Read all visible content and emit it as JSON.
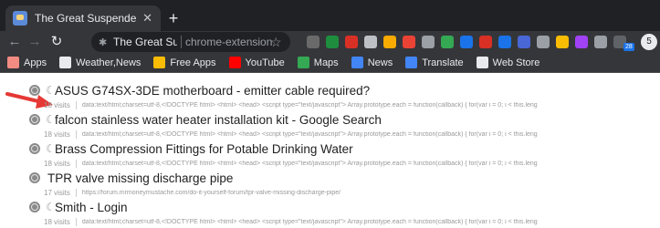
{
  "tab": {
    "title": "The Great Suspender - Recovery",
    "close": "✕",
    "new_tab": "+"
  },
  "toolbar": {
    "back": "←",
    "forward": "→",
    "reload": "↻",
    "puzzle": "✱",
    "omnibox_title": "The Great Susp",
    "omnibox_url": "chrome-extension://...",
    "star": "☆"
  },
  "extensions": [
    {
      "name": "ext-1-icon",
      "color": "#6a6a6a"
    },
    {
      "name": "ext-2-icon",
      "color": "#1e8e3e"
    },
    {
      "name": "ext-3-icon",
      "color": "#d93025"
    },
    {
      "name": "ext-4-icon",
      "color": "#bdc1c6"
    },
    {
      "name": "ext-5-icon",
      "color": "#f9ab00"
    },
    {
      "name": "ext-6-icon",
      "color": "#ea4335"
    },
    {
      "name": "ext-7-icon",
      "color": "#9aa0a6"
    },
    {
      "name": "ext-8-icon",
      "color": "#34a853"
    },
    {
      "name": "ext-9-icon",
      "color": "#1a73e8"
    },
    {
      "name": "ext-10-icon",
      "color": "#d93025"
    },
    {
      "name": "ext-11-icon",
      "color": "#1a73e8"
    },
    {
      "name": "ext-12-icon",
      "color": "#4a67d6"
    },
    {
      "name": "ext-13-icon",
      "color": "#9aa0a6"
    },
    {
      "name": "ext-14-icon",
      "color": "#fbbc04"
    },
    {
      "name": "ext-15-icon",
      "color": "#a142f4"
    },
    {
      "name": "ext-16-icon",
      "color": "#9aa0a6"
    },
    {
      "name": "ext-17-icon",
      "color": "#5f6368"
    }
  ],
  "extension_badge": "28",
  "bookmarks": [
    {
      "label": "Apps",
      "color": "#f28b82"
    },
    {
      "label": "Weather,News",
      "color": "#e8eaed"
    },
    {
      "label": "Free Apps",
      "color": "#fbbc04"
    },
    {
      "label": "YouTube",
      "color": "#ff0000"
    },
    {
      "label": "Maps",
      "color": "#34a853"
    },
    {
      "label": "News",
      "color": "#4285f4"
    },
    {
      "label": "Translate",
      "color": "#4285f4"
    },
    {
      "label": "Web Store",
      "color": "#e8eaed"
    }
  ],
  "rows": [
    {
      "title": "ASUS G74SX-3DE motherboard - emitter cable required?",
      "visits": "18 visits",
      "meta": "data:text/html;charset=utf-8,<!DOCTYPE html> <html> <head> <script type=\"text/javascript\"> Array.prototype.each = function(callback) { for(var i = 0; i < this.leng",
      "suspended": true
    },
    {
      "title": "falcon stainless water heater installation kit - Google Search",
      "visits": "18 visits",
      "meta": "data:text/html;charset=utf-8,<!DOCTYPE html> <html> <head> <script type=\"text/javascript\"> Array.prototype.each = function(callback) { for(var i = 0; i < this.leng",
      "suspended": true
    },
    {
      "title": "Brass Compression Fittings for Potable Drinking Water",
      "visits": "18 visits",
      "meta": "data:text/html;charset=utf-8,<!DOCTYPE html> <html> <head> <script type=\"text/javascript\"> Array.prototype.each = function(callback) { for(var i = 0; i < this.leng",
      "suspended": true
    },
    {
      "title": "TPR valve missing discharge pipe",
      "visits": "17 visits",
      "meta": "https://forum.mrmoneymustache.com/do-it-yourself-forum/tpr-valve-missing-discharge-pipe/",
      "suspended": false
    },
    {
      "title": "Smith - Login",
      "visits": "18 visits",
      "meta": "data:text/html;charset=utf-8,<!DOCTYPE html> <html> <head> <script type=\"text/javascript\"> Array.prototype.each = function(callback) { for(var i = 0; i < this.leng",
      "suspended": true
    }
  ]
}
